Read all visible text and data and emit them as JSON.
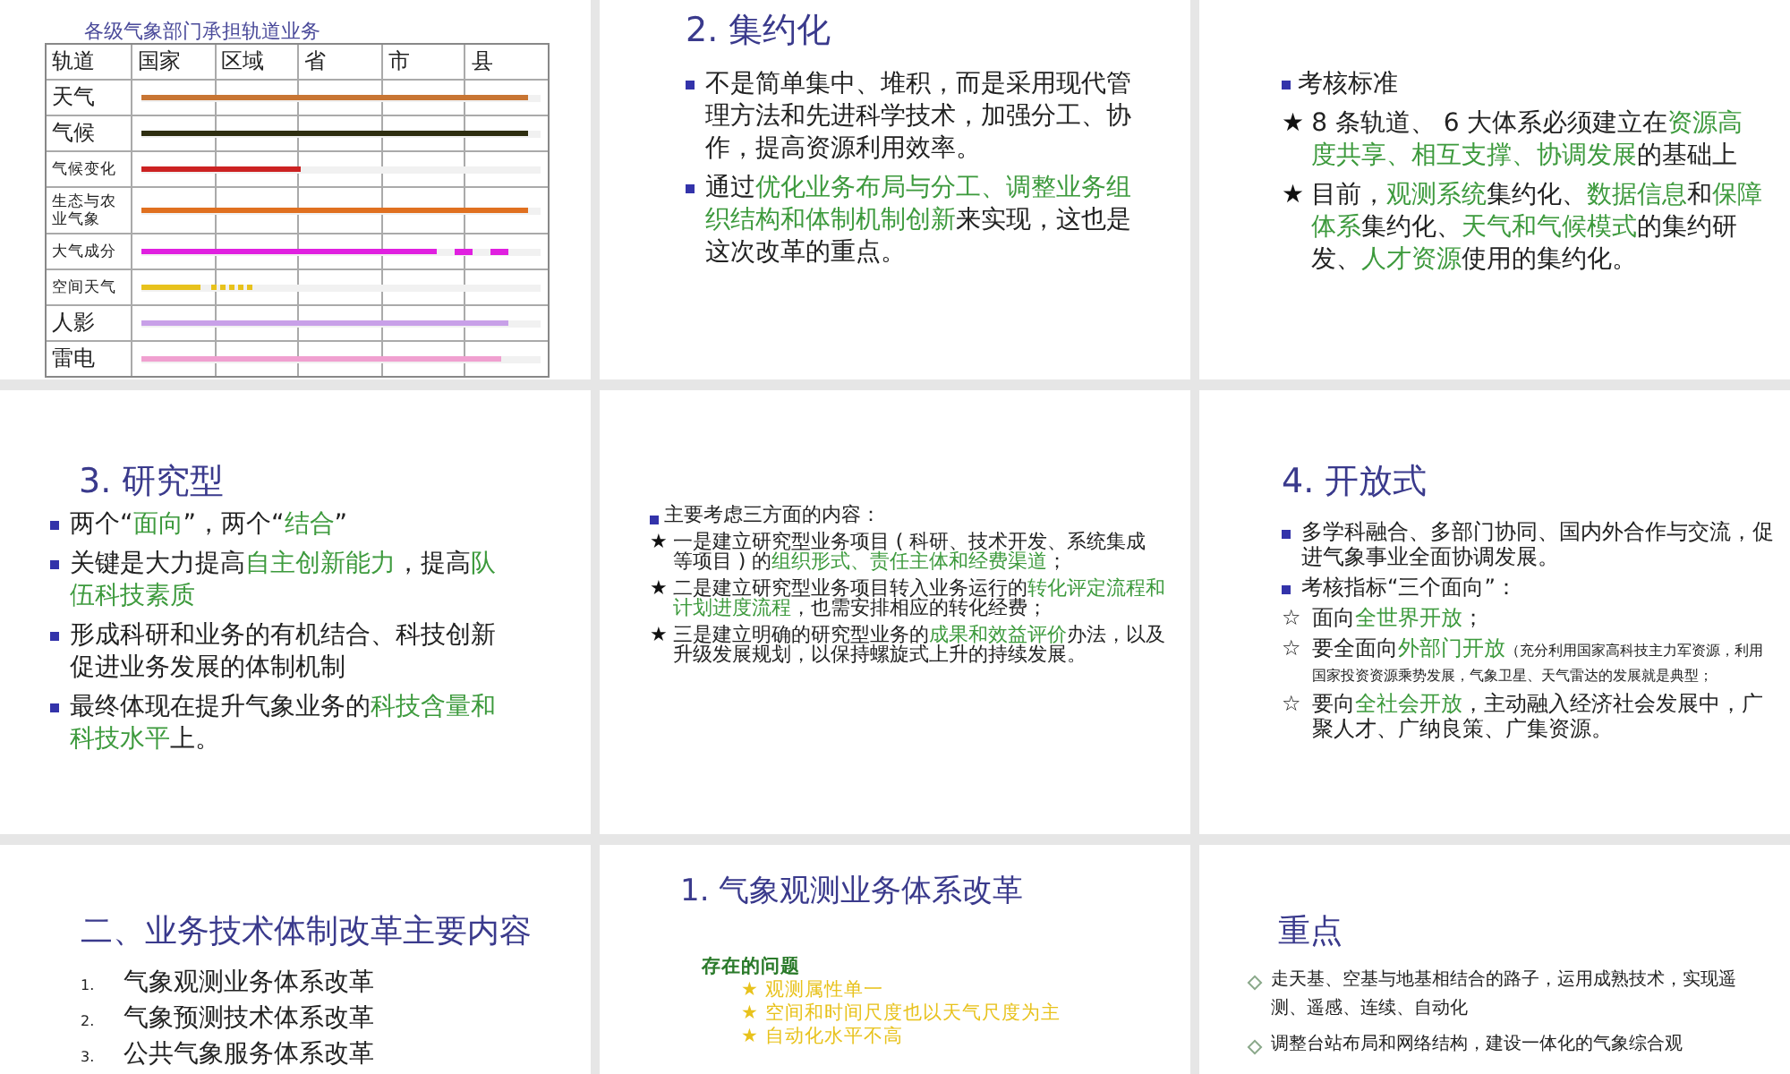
{
  "slides": [
    {
      "kind": "table",
      "title": "各级气象部门承担轨道业务",
      "columns": [
        "轨道",
        "国家",
        "区域",
        "省",
        "市",
        "县"
      ],
      "rows": [
        {
          "label": "天气",
          "kind": "solid",
          "level": 0.97,
          "color": "#c87533"
        },
        {
          "label": "气候",
          "kind": "solid",
          "level": 0.97,
          "color": "#2e2e10"
        },
        {
          "label": "气候变化",
          "kind": "solid",
          "level": 0.4,
          "color": "#cc2222"
        },
        {
          "label": "生态与农业气象",
          "kind": "solid",
          "level": 0.97,
          "color": "#e07020"
        },
        {
          "label": "大气成分",
          "kind": "dashed",
          "level": 0.74,
          "color": "#e020e0"
        },
        {
          "label": "空间天气",
          "kind": "dotted",
          "level": 0.15,
          "color": "#e8c21c"
        },
        {
          "label": "人影",
          "kind": "solid",
          "level": 0.92,
          "color": "#c8a0e8"
        },
        {
          "label": "雷电",
          "kind": "solid",
          "level": 0.9,
          "color": "#f0a0d0"
        }
      ]
    },
    {
      "kind": "bullets",
      "title": "2. 集约化",
      "items": [
        {
          "kind": "square",
          "segments": [
            {
              "kind": "plain",
              "text": "不是简单集中、堆积，而是采用现代管理方法和先进科学技术，加强分工、协作，提高资源利用效率。"
            }
          ]
        },
        {
          "kind": "square",
          "segments": [
            {
              "kind": "plain",
              "text": "通过"
            },
            {
              "kind": "green",
              "text": "优化业务布局与分工、调整业务组织结构和体制机制创新"
            },
            {
              "kind": "plain",
              "text": "来实现，这也是这次改革的重点。"
            }
          ]
        }
      ]
    },
    {
      "kind": "bullets",
      "items": [
        {
          "kind": "square",
          "segments": [
            {
              "kind": "plain",
              "text": "考核标准"
            }
          ]
        },
        {
          "kind": "mark",
          "marker": "★",
          "segments": [
            {
              "kind": "plain",
              "text": "8 条轨道、 6 大体系必须建立在"
            },
            {
              "kind": "green",
              "text": "资源高度共享、相互支撑、协调发展"
            },
            {
              "kind": "plain",
              "text": "的基础上"
            }
          ]
        },
        {
          "kind": "mark",
          "marker": "★",
          "segments": [
            {
              "kind": "plain",
              "text": "目前，"
            },
            {
              "kind": "green",
              "text": "观测系统"
            },
            {
              "kind": "plain",
              "text": "集约化、"
            },
            {
              "kind": "green",
              "text": "数据信息"
            },
            {
              "kind": "plain",
              "text": "和"
            },
            {
              "kind": "green",
              "text": "保障体系"
            },
            {
              "kind": "plain",
              "text": "集约化、"
            },
            {
              "kind": "green",
              "text": "天气和气候模式"
            },
            {
              "kind": "plain",
              "text": "的集约研发、"
            },
            {
              "kind": "green",
              "text": "人才资源"
            },
            {
              "kind": "plain",
              "text": "使用的集约化。"
            }
          ]
        }
      ]
    },
    {
      "kind": "bullets",
      "title": "3. 研究型",
      "items": [
        {
          "kind": "square",
          "segments": [
            {
              "kind": "plain",
              "text": "两个“"
            },
            {
              "kind": "green",
              "text": "面向"
            },
            {
              "kind": "plain",
              "text": "”，两个“"
            },
            {
              "kind": "green",
              "text": "结合"
            },
            {
              "kind": "plain",
              "text": "”"
            }
          ]
        },
        {
          "kind": "square",
          "segments": [
            {
              "kind": "plain",
              "text": "关键是大力提高"
            },
            {
              "kind": "green",
              "text": "自主创新能力"
            },
            {
              "kind": "plain",
              "text": "，提高"
            },
            {
              "kind": "green",
              "text": "队伍科技素质"
            }
          ]
        },
        {
          "kind": "square",
          "segments": [
            {
              "kind": "plain",
              "text": "形成科研和业务的有机结合、科技创新促进业务发展的体制机制"
            }
          ]
        },
        {
          "kind": "square",
          "segments": [
            {
              "kind": "plain",
              "text": "最终体现在提升气象业务的"
            },
            {
              "kind": "green",
              "text": "科技含量和科技水平"
            },
            {
              "kind": "plain",
              "text": "上。"
            }
          ]
        }
      ]
    },
    {
      "kind": "bullets",
      "items": [
        {
          "kind": "square",
          "segments": [
            {
              "kind": "plain",
              "text": "主要考虑三方面的内容："
            }
          ]
        },
        {
          "kind": "mark",
          "marker": "★",
          "segments": [
            {
              "kind": "plain",
              "text": "一是建立研究型业务项目 ( 科研、技术开发、系统集成等项目 ) 的"
            },
            {
              "kind": "green",
              "text": "组织形式、责任主体和经费渠道"
            },
            {
              "kind": "plain",
              "text": "；"
            }
          ]
        },
        {
          "kind": "mark",
          "marker": "★",
          "segments": [
            {
              "kind": "plain",
              "text": "二是建立研究型业务项目转入业务运行的"
            },
            {
              "kind": "green",
              "text": "转化评定流程和计划进度流程"
            },
            {
              "kind": "plain",
              "text": "，也需安排相应的转化经费；"
            }
          ]
        },
        {
          "kind": "mark",
          "marker": "★",
          "segments": [
            {
              "kind": "plain",
              "text": "三是建立明确的研究型业务的"
            },
            {
              "kind": "green",
              "text": "成果和效益评价"
            },
            {
              "kind": "plain",
              "text": "办法，以及升级发展规划，以保持螺旋式上升的持续发展。"
            }
          ]
        }
      ]
    },
    {
      "kind": "bullets",
      "title": "4. 开放式",
      "items": [
        {
          "kind": "square",
          "segments": [
            {
              "kind": "plain",
              "text": "多学科融合、多部门协同、国内外合作与交流，促进气象事业全面协调发展。"
            }
          ]
        },
        {
          "kind": "square",
          "segments": [
            {
              "kind": "plain",
              "text": "考核指标“三个面向”："
            }
          ]
        },
        {
          "kind": "mark",
          "marker": "☆",
          "segments": [
            {
              "kind": "plain",
              "text": "面向"
            },
            {
              "kind": "green",
              "text": "全世界开放"
            },
            {
              "kind": "plain",
              "text": "；"
            }
          ]
        },
        {
          "kind": "mark",
          "marker": "☆",
          "segments": [
            {
              "kind": "plain",
              "text": "要全面向"
            },
            {
              "kind": "green",
              "text": "外部门开放"
            },
            {
              "kind": "small",
              "text": "（充分利用国家高科技主力军资源，利用国家投资资源乘势发展，气象卫星、天气雷达的发展就是典型；"
            }
          ]
        },
        {
          "kind": "mark",
          "marker": "☆",
          "segments": [
            {
              "kind": "plain",
              "text": "要向"
            },
            {
              "kind": "green",
              "text": "全社会开放"
            },
            {
              "kind": "plain",
              "text": "，主动融入经济社会发展中，广聚人才、广纳良策、广集资源。"
            }
          ]
        }
      ]
    },
    {
      "kind": "numbered",
      "title": "二、业务技术体制改革主要内容",
      "items": [
        {
          "number": "1.",
          "text": "气象观测业务体系改革"
        },
        {
          "number": "2.",
          "text": "气象预测技术体系改革"
        },
        {
          "number": "3.",
          "text": "公共气象服务体系改革"
        }
      ]
    },
    {
      "kind": "problems",
      "title": "1.  气象观测业务体系改革",
      "heading": "存在的问题",
      "items": [
        {
          "marker": "★",
          "text": "观测属性单一"
        },
        {
          "marker": "★",
          "text": "空间和时间尺度也以天气尺度为主"
        },
        {
          "marker": "★",
          "text": "自动化水平不高"
        }
      ]
    },
    {
      "kind": "bullets",
      "title": "重点",
      "items": [
        {
          "kind": "diamond",
          "segments": [
            {
              "kind": "plain",
              "text": "走天基、空基与地基相结合的路子，运用成熟技术，实现遥测、遥感、连续、自动化"
            }
          ]
        },
        {
          "kind": "diamond",
          "segments": [
            {
              "kind": "plain",
              "text": "调整台站布局和网络结构，建设一体化的气象综合观"
            }
          ]
        }
      ]
    }
  ]
}
